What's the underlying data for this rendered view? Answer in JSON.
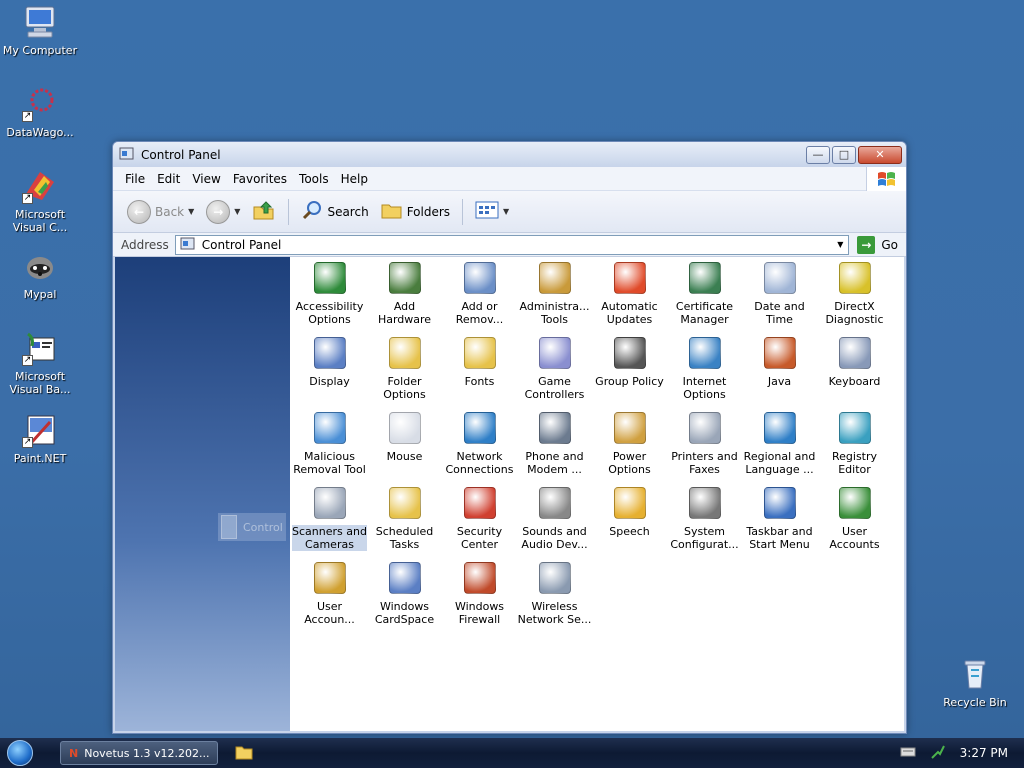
{
  "desktop": {
    "icons": [
      {
        "label": "My Computer",
        "shortcut": false
      },
      {
        "label": "DataWago...",
        "shortcut": true
      },
      {
        "label": "Microsoft Visual C...",
        "shortcut": true
      },
      {
        "label": "Mypal",
        "shortcut": false
      },
      {
        "label": "Microsoft Visual Ba...",
        "shortcut": true
      },
      {
        "label": "Paint.NET",
        "shortcut": true
      },
      {
        "label": "Recycle Bin",
        "shortcut": false
      }
    ]
  },
  "window": {
    "title": "Control Panel",
    "buttons": {
      "minimize": "—",
      "maximize": "□",
      "close": "✕"
    }
  },
  "menu": [
    "File",
    "Edit",
    "View",
    "Favorites",
    "Tools",
    "Help"
  ],
  "toolbar": {
    "back": "Back",
    "search": "Search",
    "folders": "Folders"
  },
  "address": {
    "label": "Address",
    "value": "Control Panel",
    "go": "Go"
  },
  "drag_ghost_label": "Control",
  "items": [
    {
      "label": "Accessibility Options",
      "icon": "accessibility-icon",
      "color": "#2e8b3a"
    },
    {
      "label": "Add Hardware",
      "icon": "add-hardware-icon",
      "color": "#4a7d3e"
    },
    {
      "label": "Add or Remov...",
      "icon": "add-remove-programs-icon",
      "color": "#6b8fc7"
    },
    {
      "label": "Administra... Tools",
      "icon": "administrative-tools-icon",
      "color": "#c99a3a"
    },
    {
      "label": "Automatic Updates",
      "icon": "windows-logo-icon",
      "color": "#e04b2a"
    },
    {
      "label": "Certificate Manager",
      "icon": "certificate-icon",
      "color": "#3b7f52"
    },
    {
      "label": "Date and Time",
      "icon": "clock-icon",
      "color": "#a0b5d6"
    },
    {
      "label": "DirectX Diagnostic",
      "icon": "directx-icon",
      "color": "#d8c12a"
    },
    {
      "label": "Display",
      "icon": "display-icon",
      "color": "#5b7fc4"
    },
    {
      "label": "Folder Options",
      "icon": "folder-options-icon",
      "color": "#e6c24a"
    },
    {
      "label": "Fonts",
      "icon": "fonts-icon",
      "color": "#e6c24a"
    },
    {
      "label": "Game Controllers",
      "icon": "gamepad-icon",
      "color": "#8a8fd0"
    },
    {
      "label": "Group Policy",
      "icon": "group-policy-icon",
      "color": "#555555"
    },
    {
      "label": "Internet Options",
      "icon": "internet-options-icon",
      "color": "#3a82c4"
    },
    {
      "label": "Java",
      "icon": "java-icon",
      "color": "#c75a2a"
    },
    {
      "label": "Keyboard",
      "icon": "keyboard-icon",
      "color": "#8899b8"
    },
    {
      "label": "Malicious Removal Tool",
      "icon": "malicious-removal-icon",
      "color": "#4a8fd6"
    },
    {
      "label": "Mouse",
      "icon": "mouse-icon",
      "color": "#d8dde6"
    },
    {
      "label": "Network Connections",
      "icon": "network-connections-icon",
      "color": "#2f7fc7"
    },
    {
      "label": "Phone and Modem ...",
      "icon": "phone-modem-icon",
      "color": "#6c7b8f"
    },
    {
      "label": "Power Options",
      "icon": "power-options-icon",
      "color": "#d0a040"
    },
    {
      "label": "Printers and Faxes",
      "icon": "printer-icon",
      "color": "#9aa6b8"
    },
    {
      "label": "Regional and Language ...",
      "icon": "globe-icon",
      "color": "#2f7fc7"
    },
    {
      "label": "Registry Editor",
      "icon": "registry-icon",
      "color": "#3aa0c0"
    },
    {
      "label": "Scanners and Cameras",
      "icon": "scanner-camera-icon",
      "color": "#9aa6b8",
      "selected": true
    },
    {
      "label": "Scheduled Tasks",
      "icon": "scheduled-tasks-icon",
      "color": "#e6c24a"
    },
    {
      "label": "Security Center",
      "icon": "shield-icon",
      "color": "#d04030"
    },
    {
      "label": "Sounds and Audio Dev...",
      "icon": "speaker-icon",
      "color": "#888888"
    },
    {
      "label": "Speech",
      "icon": "speech-icon",
      "color": "#e6b030"
    },
    {
      "label": "System Configurat...",
      "icon": "system-config-icon",
      "color": "#777777"
    },
    {
      "label": "Taskbar and Start Menu",
      "icon": "taskbar-icon",
      "color": "#3a6fc0"
    },
    {
      "label": "User Accounts",
      "icon": "user-accounts-icon",
      "color": "#3a8f3a"
    },
    {
      "label": "User Accoun...",
      "icon": "user-key-icon",
      "color": "#d0a030"
    },
    {
      "label": "Windows CardSpace",
      "icon": "cardspace-icon",
      "color": "#5b7fc4"
    },
    {
      "label": "Windows Firewall",
      "icon": "firewall-icon",
      "color": "#c04a2a"
    },
    {
      "label": "Wireless Network Se...",
      "icon": "wireless-icon",
      "color": "#8a9ab0"
    }
  ],
  "taskbar": {
    "task_label": "Novetus 1.3 v12.202...",
    "clock": "3:27 PM"
  }
}
